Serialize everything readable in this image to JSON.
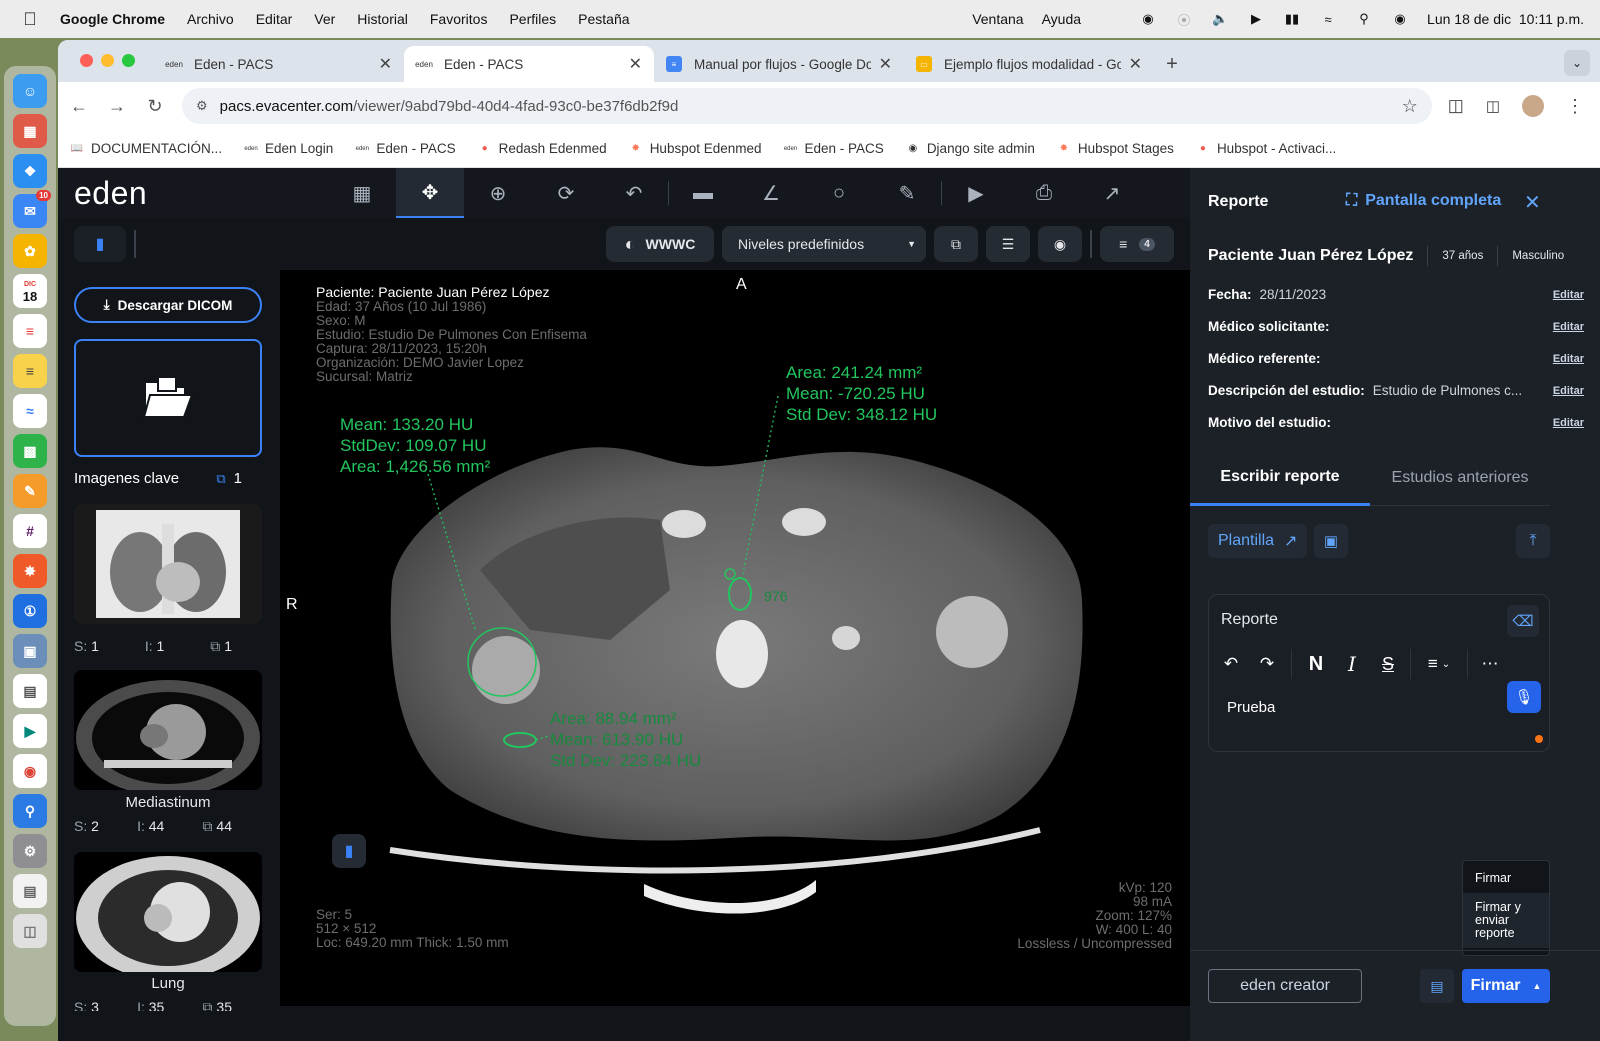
{
  "menubar": {
    "app": "Google Chrome",
    "items": [
      "Archivo",
      "Editar",
      "Ver",
      "Historial",
      "Favoritos",
      "Perfiles",
      "Pestaña"
    ],
    "right_items": [
      "Ventana",
      "Ayuda"
    ],
    "datetime": "Lun 18 de dic  10:11 p.m."
  },
  "dock": {
    "calendar_day": "18",
    "calendar_month": "DIC",
    "mail_badge": "10"
  },
  "browser": {
    "tabs": [
      {
        "title": "Eden - PACS",
        "active": false
      },
      {
        "title": "Eden - PACS",
        "active": true
      },
      {
        "title": "Manual por flujos - Google Do",
        "active": false
      },
      {
        "title": "Ejemplo flujos modalidad - Go",
        "active": false
      }
    ],
    "url_host": "pacs.evacenter.com",
    "url_path": "/viewer/9abd79bd-40d4-4fad-93c0-be37f6db2f9d",
    "bookmarks": [
      "DOCUMENTACIÓN...",
      "Eden Login",
      "Eden - PACS",
      "Redash Edenmed",
      "Hubspot Edenmed",
      "Eden - PACS",
      "Django site admin",
      "Hubspot Stages",
      "Hubspot - Activaci..."
    ]
  },
  "viewer": {
    "logo": "eden",
    "wwwc_label": "WWWC",
    "presets_label": "Niveles predefinidos",
    "list_count": "4",
    "download_label": "Descargar DICOM",
    "key_images_label": "Imagenes clave",
    "key_images_count": "1",
    "series": [
      {
        "label": "",
        "s": "1",
        "i": "1",
        "n": "1"
      },
      {
        "label": "Mediastinum",
        "s": "2",
        "i": "44",
        "n": "44"
      },
      {
        "label": "Lung",
        "s": "3",
        "i": "35",
        "n": "35"
      }
    ],
    "overlay": {
      "patient": "Paciente: Paciente Juan Pérez López",
      "age": "Edad: 37 Años (10 Jul 1986)",
      "sex": "Sexo: M",
      "study": "Estudio: Estudio De Pulmones Con Enfisema",
      "capture": "Captura: 28/11/2023, 15:20h",
      "org": "Organización: DEMO Javier Lopez",
      "branch": "Sucursal: Matriz",
      "orient_top": "A",
      "orient_left": "R",
      "ser": "Ser: 5",
      "matrix": "512 × 512",
      "loc": "Loc: 649.20 mm Thick: 1.50 mm",
      "kvp": "kVp: 120",
      "ma": "98 mA",
      "zoom": "Zoom: 127%",
      "wl": "W: 400 L: 40",
      "compression": "Lossless / Uncompressed"
    },
    "measurements": {
      "left": [
        "Mean: 133.20 HU",
        "StdDev: 109.07 HU",
        "Area: 1,426.56 mm²"
      ],
      "right": [
        "Area: 241.24 mm²",
        "Mean: -720.25 HU",
        "Std Dev: 348.12 HU"
      ],
      "bottom": [
        "Area: 88.94 mm²",
        "Mean: 613.90 HU",
        "Std Dev: 223.84 HU"
      ],
      "small": "976"
    }
  },
  "panel": {
    "title": "Reporte",
    "fullscreen_label": "Pantalla completa",
    "patient_name": "Paciente Juan Pérez López",
    "age": "37 años",
    "sex": "Masculino",
    "fields": [
      {
        "label": "Fecha:",
        "value": "28/11/2023",
        "edit": "Editar"
      },
      {
        "label": "Médico solicitante:",
        "value": "",
        "edit": "Editar"
      },
      {
        "label": "Médico referente:",
        "value": "",
        "edit": "Editar"
      },
      {
        "label": "Descripción del estudio:",
        "value": "Estudio de Pulmones c...",
        "edit": "Editar"
      },
      {
        "label": "Motivo del estudio:",
        "value": "",
        "edit": "Editar"
      }
    ],
    "tab_write": "Escribir reporte",
    "tab_previous": "Estudios anteriores",
    "template_label": "Plantilla",
    "editor_title": "Reporte",
    "editor_text": "Prueba",
    "bold_glyph": "N",
    "italic_glyph": "I",
    "strike_glyph": "S",
    "sign_menu": [
      "Firmar",
      "Firmar y enviar reporte"
    ],
    "creator_label": "eden creator",
    "sign_button": "Firmar"
  },
  "colors": {
    "accent": "#3b82f6",
    "measure": "#22c55e",
    "panel_bg": "#1c2128",
    "app_bg": "#111418"
  }
}
